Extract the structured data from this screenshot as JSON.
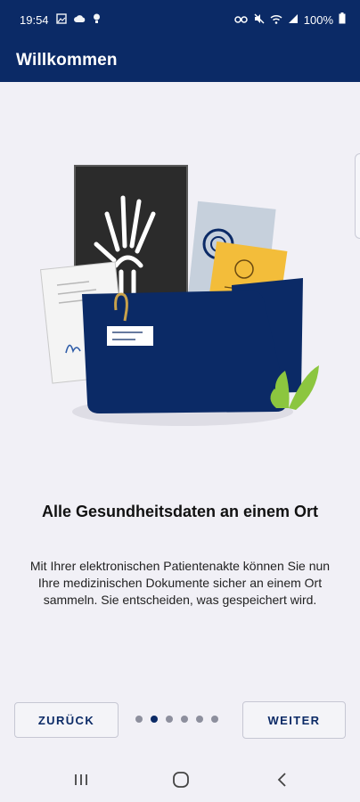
{
  "status_bar": {
    "time": "19:54",
    "battery": "100%",
    "left_icons": [
      "gallery-icon",
      "cloud-icon",
      "bulb-icon"
    ],
    "right_icons": [
      "vpn-key-icon",
      "mute-icon",
      "wifi-icon",
      "signal-icon",
      "battery-icon"
    ]
  },
  "app_bar": {
    "title": "Willkommen"
  },
  "illustration": {
    "label_lines": [
      "nnn nnn",
      "nnnnnn"
    ],
    "colors": {
      "folder": "#0b2a66",
      "xray": "#2b2b2b",
      "yellow_card": "#f3bd3a",
      "leaf": "#8cc63f"
    }
  },
  "onboarding": {
    "headline": "Alle Gesundheitsdaten an einem Ort",
    "body": "Mit Ihrer elektronischen Patientenakte können Sie nun Ihre medizinischen Dokumente sicher an einem Ort sammeln. Sie entscheiden, was gespeichert wird."
  },
  "pager": {
    "total": 6,
    "current": 2
  },
  "buttons": {
    "back": "ZURÜCK",
    "next": "WEITER"
  },
  "nav_bar": {
    "icons": [
      "recent-apps-icon",
      "home-icon",
      "back-icon"
    ]
  },
  "colors": {
    "primary": "#0b2a66",
    "background": "#f1f0f6"
  }
}
